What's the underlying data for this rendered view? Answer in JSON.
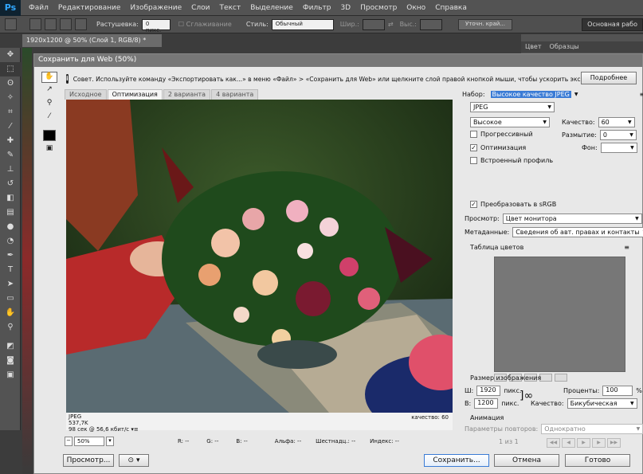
{
  "app": {
    "logo": "Ps"
  },
  "menu": [
    "Файл",
    "Редактирование",
    "Изображение",
    "Слои",
    "Текст",
    "Выделение",
    "Фильтр",
    "3D",
    "Просмотр",
    "Окно",
    "Справка"
  ],
  "options": {
    "feather_label": "Растушевка:",
    "feather_value": "0 пикс.",
    "antialias_label": "Сглаживание",
    "style_label": "Стиль:",
    "style_value": "Обычный",
    "width_label": "Шир.:",
    "height_label": "Выс.:",
    "refine_label": "Уточн. край...",
    "workspace": "Основная рабо"
  },
  "document_tab": "1920x1200 @ 50% (Слой 1, RGB/8) *",
  "right_panel_tabs": [
    "Цвет",
    "Образцы"
  ],
  "dialog": {
    "title": "Сохранить для Web (50%)",
    "tip": "Совет. Используйте команду «Экспортировать как...» в меню «Файл» > «Сохранить для Web» или щелкните слой правой кнопкой мыши, чтобы ускорить экспорт ресурсов",
    "more_button": "Подробнее",
    "view_tabs": [
      "Исходное",
      "Оптимизация",
      "2 варианта",
      "4 варианта"
    ],
    "preview": {
      "format": "JPEG",
      "size": "537,7K",
      "time": "98 сек @ 56,6 кбит/с",
      "quality": "качество: 60"
    },
    "status": {
      "zoom": "50%",
      "r": "R: --",
      "g": "G: --",
      "b": "B: --",
      "alpha": "Альфа: --",
      "hex": "Шестнадц.: --",
      "index": "Индекс: --"
    },
    "settings": {
      "preset_label": "Набор:",
      "preset_value": "Высокое качество JPEG",
      "format_value": "JPEG",
      "quality_level": "Высокое",
      "quality_label": "Качество:",
      "quality_value": "60",
      "progressive": "Прогрессивный",
      "blur_label": "Размытие:",
      "blur_value": "0",
      "optimized": "Оптимизация",
      "matte_label": "Фон:",
      "embed_profile": "Встроенный профиль",
      "convert_srgb": "Преобразовать в sRGB",
      "preview_label": "Просмотр:",
      "preview_value": "Цвет монитора",
      "metadata_label": "Метаданные:",
      "metadata_value": "Сведения об авт. правах и контакты",
      "color_table_label": "Таблица цветов"
    },
    "image_size": {
      "title": "Размер изображения",
      "w_label": "Ш:",
      "w_value": "1920",
      "h_label": "В:",
      "h_value": "1200",
      "unit": "пикс.",
      "percent_label": "Проценты:",
      "percent_value": "100",
      "percent_unit": "%",
      "quality_label": "Качество:",
      "quality_value": "Бикубическая"
    },
    "animation": {
      "title": "Анимация",
      "loop_label": "Параметры повторов:",
      "loop_value": "Однократно",
      "frame": "1 из 1"
    },
    "buttons": {
      "preview": "Просмотр...",
      "save": "Сохранить...",
      "cancel": "Отмена",
      "done": "Готово"
    }
  }
}
